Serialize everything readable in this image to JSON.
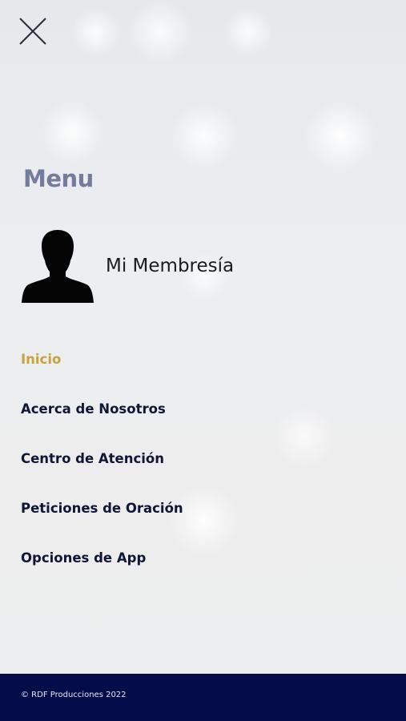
{
  "header": {
    "close_icon": "close-icon"
  },
  "menu": {
    "title": "Menu"
  },
  "membership": {
    "label": "Mi Membresía",
    "avatar_icon": "user-silhouette-icon"
  },
  "nav": {
    "items": [
      {
        "label": "Inicio",
        "active": true
      },
      {
        "label": "Acerca de Nosotros",
        "active": false
      },
      {
        "label": "Centro de Atención",
        "active": false
      },
      {
        "label": "Peticiones de Oración",
        "active": false
      },
      {
        "label": "Opciones de App",
        "active": false
      }
    ]
  },
  "footer": {
    "copyright": "© RDF Producciones 2022"
  },
  "colors": {
    "active_item": "#c9a23c",
    "nav_text": "#101636",
    "menu_title": "#737c9c",
    "footer_bg": "#040c4a"
  }
}
